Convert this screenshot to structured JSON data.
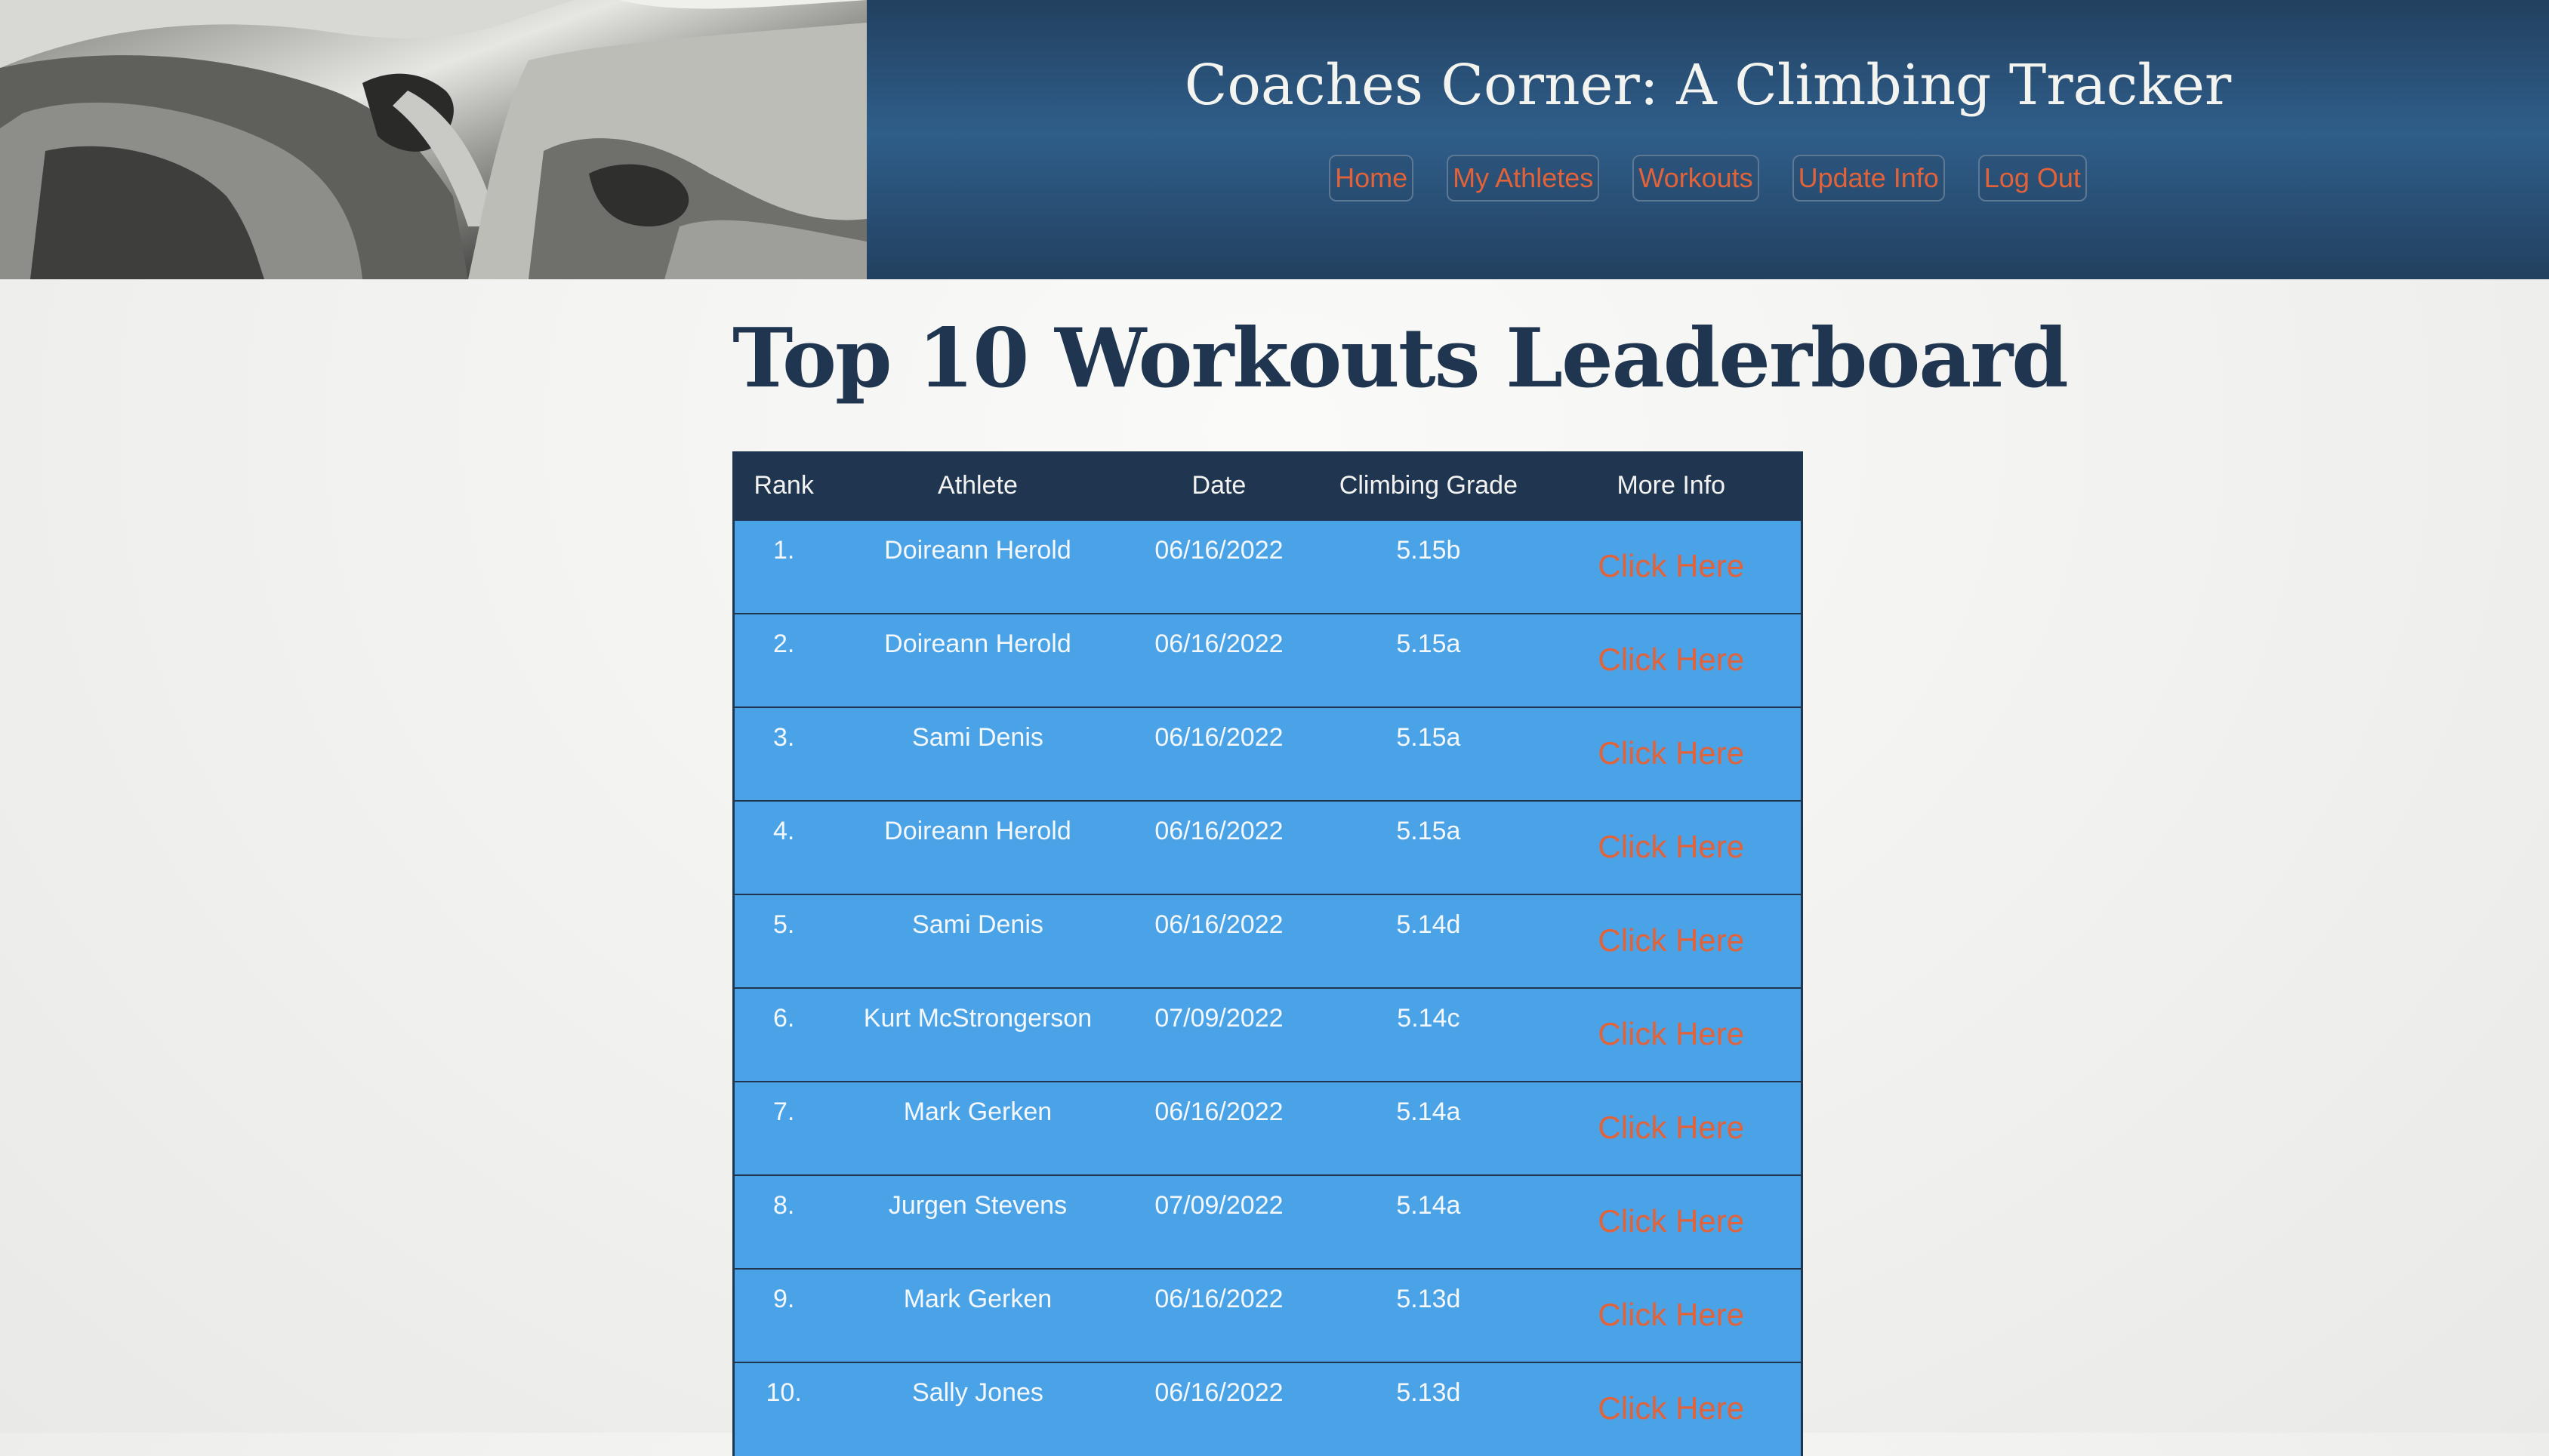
{
  "header": {
    "title": "Coaches Corner: A Climbing Tracker",
    "nav": [
      {
        "label": "Home",
        "name": "nav-home-button"
      },
      {
        "label": "My Athletes",
        "name": "nav-my-athletes-button"
      },
      {
        "label": "Workouts",
        "name": "nav-workouts-button"
      },
      {
        "label": "Update Info",
        "name": "nav-update-info-button"
      },
      {
        "label": "Log Out",
        "name": "nav-log-out-button"
      }
    ],
    "hero_image": "black-and-white-bouldering-photo"
  },
  "main": {
    "title": "Top 10 Workouts Leaderboard",
    "table": {
      "columns": [
        "Rank",
        "Athlete",
        "Date",
        "Climbing Grade",
        "More Info"
      ],
      "rows": [
        {
          "rank": "1.",
          "athlete": "Doireann Herold",
          "date": "06/16/2022",
          "grade": "5.15b",
          "more": "Click Here"
        },
        {
          "rank": "2.",
          "athlete": "Doireann Herold",
          "date": "06/16/2022",
          "grade": "5.15a",
          "more": "Click Here"
        },
        {
          "rank": "3.",
          "athlete": "Sami Denis",
          "date": "06/16/2022",
          "grade": "5.15a",
          "more": "Click Here"
        },
        {
          "rank": "4.",
          "athlete": "Doireann Herold",
          "date": "06/16/2022",
          "grade": "5.15a",
          "more": "Click Here"
        },
        {
          "rank": "5.",
          "athlete": "Sami Denis",
          "date": "06/16/2022",
          "grade": "5.14d",
          "more": "Click Here"
        },
        {
          "rank": "6.",
          "athlete": "Kurt McStrongerson",
          "date": "07/09/2022",
          "grade": "5.14c",
          "more": "Click Here"
        },
        {
          "rank": "7.",
          "athlete": "Mark Gerken",
          "date": "06/16/2022",
          "grade": "5.14a",
          "more": "Click Here"
        },
        {
          "rank": "8.",
          "athlete": "Jurgen Stevens",
          "date": "07/09/2022",
          "grade": "5.14a",
          "more": "Click Here"
        },
        {
          "rank": "9.",
          "athlete": "Mark Gerken",
          "date": "06/16/2022",
          "grade": "5.13d",
          "more": "Click Here"
        },
        {
          "rank": "10.",
          "athlete": "Sally Jones",
          "date": "06/16/2022",
          "grade": "5.13d",
          "more": "Click Here"
        }
      ]
    }
  },
  "colors": {
    "navy": "#1f3550",
    "row_blue": "#4aa3e6",
    "accent_orange": "#e2623a",
    "banner_mid": "#2f5e8a"
  }
}
